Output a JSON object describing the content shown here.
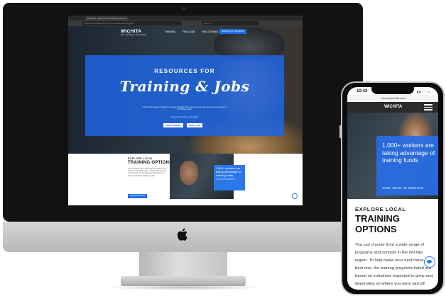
{
  "colors": {
    "brand_blue": "#1f6fe5",
    "dark": "#121212"
  },
  "desktop": {
    "browser": {
      "tab_title": "WICHITA · Resources for Training & Jobs",
      "url": "https://chooseWICHITA.com/resources-training-jobs",
      "search_placeholder": "Search"
    },
    "nav": {
      "logo": "WICHITA",
      "logo_sub": "GET TRAINED. GET HIRED.",
      "links": [
        "TRAINING",
        "FIND A JOB",
        "REAL STORIES"
      ],
      "cta": "ENROLL IN TRAINING"
    },
    "hero": {
      "title_top": "RESOURCES FOR",
      "title_script": "Training & Jobs",
      "text": "Laid off, furloughed or looking for a career change? These resources can help you find your next step in the Wichita region.",
      "text2": "Find your next move. Get started.",
      "btn1": "FIND TRAINING",
      "btn2": "FIND A JOB"
    },
    "section": {
      "eyebrow": "EXPLORE LOCAL",
      "title": "TRAINING OPTIONS",
      "body": "You can choose from a wide range of programs and schools in the Wichita region. To help make your next move the best one, the training programs listed are based on industries expected to grow.",
      "button": "FIND PROGRAMS",
      "stat": "1,000+ workers are taking advantage of training funds",
      "stat_sub": "THIS YEAR IN WICHITA"
    }
  },
  "mobile": {
    "time": "10:43",
    "url": "choosewichita.com",
    "logo": "WICHITA",
    "stat": "1,000+ workers are taking advantage of training funds",
    "stat_sub": "THIS YEAR IN WICHITA",
    "eyebrow": "EXPLORE LOCAL",
    "title": "TRAINING OPTIONS",
    "body": "You can choose from a wide range of programs and schools in the Wichita region. To help make your next move the best one, the training programs listed are based on industries expected to grow and, depending on where you were laid off from, you may qualify to get your training paid for"
  }
}
